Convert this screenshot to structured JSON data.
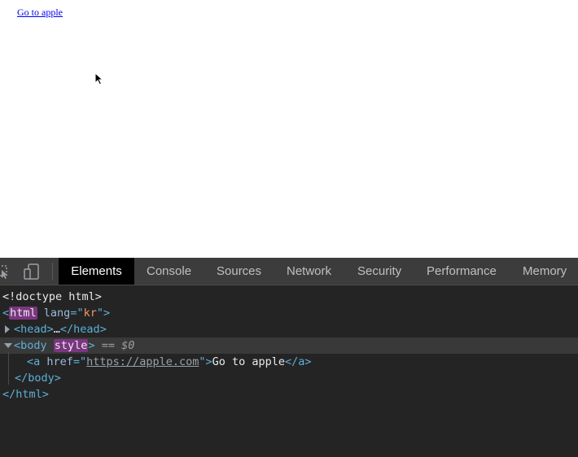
{
  "page": {
    "link_text": "Go to apple"
  },
  "devtools": {
    "toolbar": {
      "inspect_icon": "inspect-element-icon",
      "device_icon": "device-toolbar-icon",
      "tabs": [
        {
          "label": "Elements",
          "active": true
        },
        {
          "label": "Console",
          "active": false
        },
        {
          "label": "Sources",
          "active": false
        },
        {
          "label": "Network",
          "active": false
        },
        {
          "label": "Security",
          "active": false
        },
        {
          "label": "Performance",
          "active": false
        },
        {
          "label": "Memory",
          "active": false
        }
      ]
    },
    "dom": {
      "doctype": "<!doctype html>",
      "html_open_lt": "<",
      "html_tag": "html",
      "html_attr_name": "lang",
      "html_attr_eq": "=\"",
      "html_attr_value": "kr",
      "html_attr_close": "\">",
      "head_open": "<head>",
      "head_ellipsis": "…",
      "head_close": "</head>",
      "body_open_lt": "<body ",
      "body_attr": "style",
      "body_open_gt": ">",
      "body_marker": " == $0",
      "a_open": "<a ",
      "a_attr_name": "href",
      "a_attr_eq": "=\"",
      "a_href": "https://apple.com",
      "a_attr_close": "\">",
      "a_text": "Go to apple",
      "a_close": "</a>",
      "body_close": "</body>",
      "html_close": "</html>"
    },
    "colors": {
      "toolbar_bg": "#3c3c3c",
      "panel_bg": "#242424",
      "tag": "#5db0d7",
      "attr_value": "#f29766",
      "highlight": "#7b3680"
    }
  }
}
